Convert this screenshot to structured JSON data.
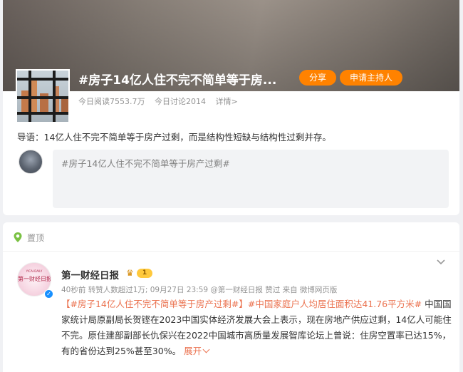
{
  "topic": {
    "title": "#房子14亿人住不完不简单等于房...",
    "share_label": "分享",
    "host_label": "申请主持人",
    "stats": {
      "reads": "今日阅读7553.7万",
      "discuss": "今日讨论2014",
      "detail": "详情>"
    },
    "intro": "导语：14亿人住不完不简单等于房产过剩，而是结构性短缺与结构性过剩并存。",
    "compose_text": "#房子14亿人住不完不简单等于房产过剩#"
  },
  "pinned": {
    "label": "置顶"
  },
  "post": {
    "author": "第一财经日报",
    "badge_level": "1",
    "avatar_logo": "第一财经日报",
    "avatar_sub": "YICAI·DAILY",
    "meta": "40秒前 转赞人数超过1万; 09月27日 23:59 @第一财经日报 赞过  来自 微博网页版",
    "tag1": "【#房子14亿人住不完不简单等于房产过剩#】",
    "tag2": "#中国家庭户人均居住面积达41.76平方米#",
    "text": " 中国国家统计局原副局长贺铿在2023中国实体经济发展大会上表示，现在房地产供应过剩，14亿人可能住不完。原住建部副部长仇保兴在2022中国城市高质量发展智库论坛上曾说：住房空置率已达15%，有的省份达到25%甚至30%。",
    "more_label": "展开"
  },
  "colors": {
    "accent_orange": "#ff8200",
    "link_orange": "#eb7350",
    "verify_blue": "#1890ff"
  },
  "icons": [
    "pin-icon",
    "crown-icon",
    "verified-icon",
    "chevron-down-icon"
  ]
}
